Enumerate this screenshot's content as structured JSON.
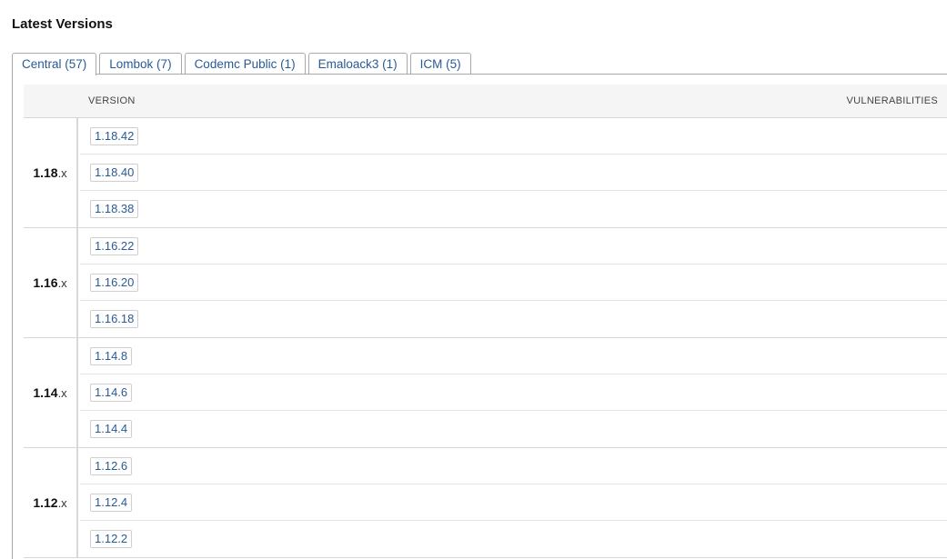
{
  "title": "Latest Versions",
  "tabs": [
    {
      "label": "Central (57)",
      "active": true
    },
    {
      "label": "Lombok (7)",
      "active": false
    },
    {
      "label": "Codemc Public (1)",
      "active": false
    },
    {
      "label": "Emaloack3 (1)",
      "active": false
    },
    {
      "label": "ICM (5)",
      "active": false
    }
  ],
  "table": {
    "headers": {
      "version": "VERSION",
      "vulnerabilities": "VULNERABILITIES"
    },
    "groups": [
      {
        "major": "1.18",
        "suffix": ".x",
        "versions": [
          "1.18.42",
          "1.18.40",
          "1.18.38"
        ]
      },
      {
        "major": "1.16",
        "suffix": ".x",
        "versions": [
          "1.16.22",
          "1.16.20",
          "1.16.18"
        ]
      },
      {
        "major": "1.14",
        "suffix": ".x",
        "versions": [
          "1.14.8",
          "1.14.6",
          "1.14.4"
        ]
      },
      {
        "major": "1.12",
        "suffix": ".x",
        "versions": [
          "1.12.6",
          "1.12.4",
          "1.12.2"
        ]
      }
    ]
  },
  "colors": {
    "link": "#2a5a95",
    "border": "#aaaaaa",
    "header_bg": "#f5f5f5"
  }
}
